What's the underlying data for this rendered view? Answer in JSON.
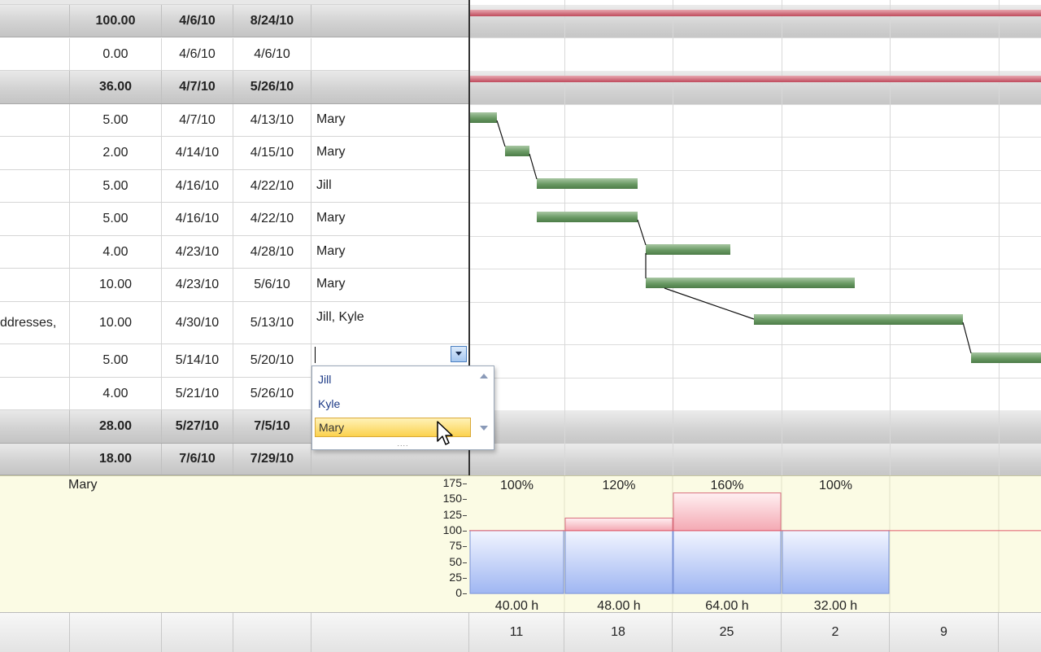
{
  "task_grid": {
    "rows": [
      {
        "name": "",
        "work": "100.00",
        "start": "4/6/10",
        "finish": "8/24/10",
        "resources": "",
        "summary": true
      },
      {
        "name": "",
        "work": "0.00",
        "start": "4/6/10",
        "finish": "4/6/10",
        "resources": "",
        "summary": false
      },
      {
        "name": "",
        "work": "36.00",
        "start": "4/7/10",
        "finish": "5/26/10",
        "resources": "",
        "summary": true
      },
      {
        "name": "",
        "work": "5.00",
        "start": "4/7/10",
        "finish": "4/13/10",
        "resources": "Mary",
        "summary": false
      },
      {
        "name": "",
        "work": "2.00",
        "start": "4/14/10",
        "finish": "4/15/10",
        "resources": "Mary",
        "summary": false
      },
      {
        "name": "",
        "work": "5.00",
        "start": "4/16/10",
        "finish": "4/22/10",
        "resources": "Jill",
        "summary": false
      },
      {
        "name": "",
        "work": "5.00",
        "start": "4/16/10",
        "finish": "4/22/10",
        "resources": "Mary",
        "summary": false
      },
      {
        "name": "",
        "work": "4.00",
        "start": "4/23/10",
        "finish": "4/28/10",
        "resources": "Mary",
        "summary": false
      },
      {
        "name": "",
        "work": "10.00",
        "start": "4/23/10",
        "finish": "5/6/10",
        "resources": "Mary",
        "summary": false
      },
      {
        "name": "ddresses,",
        "work": "10.00",
        "start": "4/30/10",
        "finish": "5/13/10",
        "resources": "Jill, Kyle",
        "summary": false
      },
      {
        "name": "",
        "work": "5.00",
        "start": "5/14/10",
        "finish": "5/20/10",
        "resources": "",
        "summary": false
      },
      {
        "name": "",
        "work": "4.00",
        "start": "5/21/10",
        "finish": "5/26/10",
        "resources": "",
        "summary": false
      },
      {
        "name": "",
        "work": "28.00",
        "start": "5/27/10",
        "finish": "7/5/10",
        "resources": "",
        "summary": true
      },
      {
        "name": "",
        "work": "18.00",
        "start": "7/6/10",
        "finish": "7/29/10",
        "resources": "",
        "summary": true
      }
    ]
  },
  "resource_dropdown": {
    "options": [
      "Jill",
      "Kyle",
      "Mary"
    ],
    "selected": "Mary",
    "current_value": ""
  },
  "histogram": {
    "resource_name": "Mary",
    "y_ticks": [
      "175",
      "150",
      "125",
      "100",
      "75",
      "50",
      "25",
      "0"
    ],
    "weeks": [
      {
        "percent": "100%",
        "hours": "40.00 h",
        "level": 100
      },
      {
        "percent": "120%",
        "hours": "48.00 h",
        "level": 120
      },
      {
        "percent": "160%",
        "hours": "64.00 h",
        "level": 160
      },
      {
        "percent": "100%",
        "hours": "32.00 h",
        "level": 100
      }
    ],
    "colors": {
      "allocated": "#9fb6f2",
      "overallocated": "#f4a9b3",
      "limit_line": "#e05a6a"
    }
  },
  "timescale": {
    "labels": [
      "11",
      "18",
      "25",
      "2",
      "9"
    ]
  },
  "icons": {
    "dropdown": "chevron-down-icon",
    "scroll_up": "triangle-up-icon",
    "scroll_down": "triangle-down-icon",
    "cursor": "mouse-pointer-icon"
  }
}
